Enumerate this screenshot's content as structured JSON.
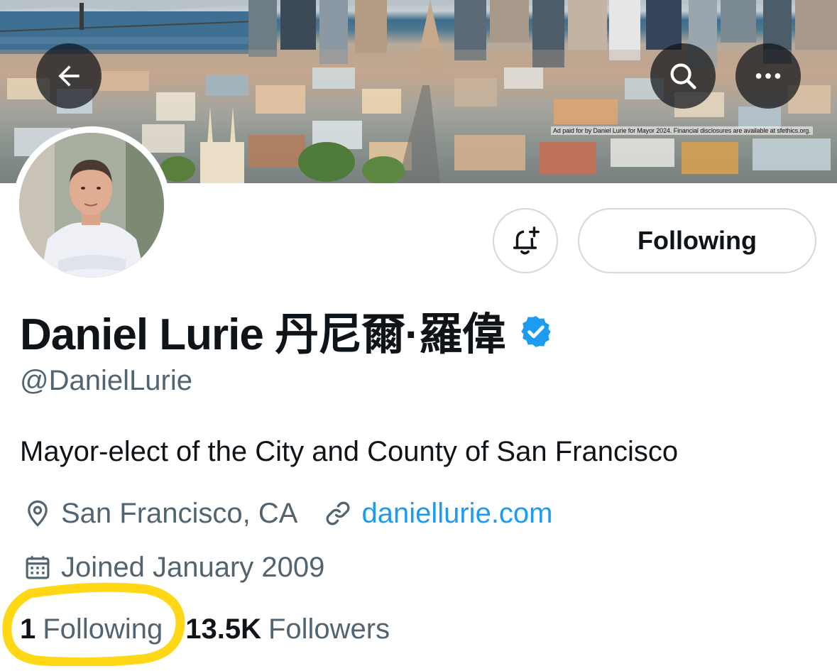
{
  "banner": {
    "ad_disclaimer": "Ad paid for by Daniel Lurie for Mayor 2024. Financial disclosures are available at sfethics.org."
  },
  "header_buttons": {
    "back_icon": "arrow-left-icon",
    "search_icon": "search-icon",
    "more_icon": "more-horizontal-icon"
  },
  "actions": {
    "notify_icon": "bell-plus-icon",
    "following_label": "Following"
  },
  "profile": {
    "display_name": "Daniel Lurie 丹尼爾·羅偉",
    "verified_icon": "verified-badge-icon",
    "handle": "@DanielLurie",
    "bio": "Mayor-elect of the City and County of San Francisco",
    "location": "San Francisco, CA",
    "website": "daniellurie.com",
    "joined": "Joined January 2009"
  },
  "stats": {
    "following_count": "1",
    "following_label": "Following",
    "followers_count": "13.5K",
    "followers_label": "Followers"
  },
  "colors": {
    "verified_blue": "#1d9bf0",
    "link_blue": "#1d9bf0",
    "secondary_text": "#536471",
    "highlight_yellow": "#ffd400"
  }
}
